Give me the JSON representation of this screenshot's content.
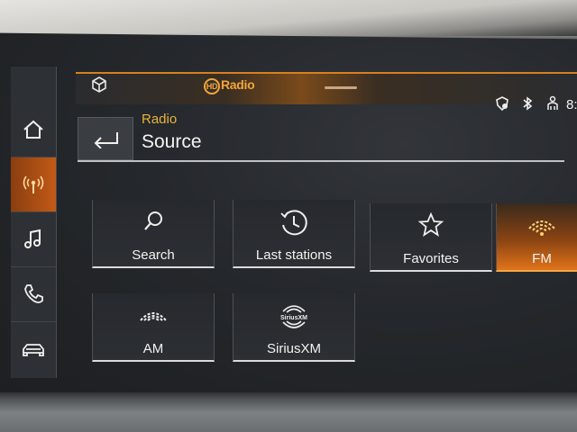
{
  "status_bar": {
    "hd_radio_prefix": "HD",
    "hd_radio_label": "Radio",
    "clock_fragment": "8:"
  },
  "header": {
    "breadcrumb": "Radio",
    "title": "Source"
  },
  "sidebar": {
    "items": [
      {
        "name": "home",
        "icon": "home-icon",
        "active": false
      },
      {
        "name": "radio",
        "icon": "radio-antenna-icon",
        "active": true
      },
      {
        "name": "music",
        "icon": "music-note-icon",
        "active": false
      },
      {
        "name": "phone",
        "icon": "phone-icon",
        "active": false
      },
      {
        "name": "car",
        "icon": "car-icon",
        "active": false
      }
    ]
  },
  "sources": [
    {
      "label": "Search",
      "icon": "search-icon",
      "active": false
    },
    {
      "label": "Last stations",
      "icon": "clock-history-icon",
      "active": false
    },
    {
      "label": "Favorites",
      "icon": "star-icon",
      "active": false
    },
    {
      "label": "FM",
      "icon": "fm-signal-icon",
      "active": true
    },
    {
      "label": "AM",
      "icon": "am-signal-icon",
      "active": false
    },
    {
      "label": "SiriusXM",
      "icon": "siriusxm-icon",
      "active": false
    }
  ],
  "siriusxm_logo_text": "SiriusXM",
  "colors": {
    "accent": "#e0731a",
    "breadcrumb": "#e7b43c",
    "hd_logo": "#f1a63a"
  }
}
